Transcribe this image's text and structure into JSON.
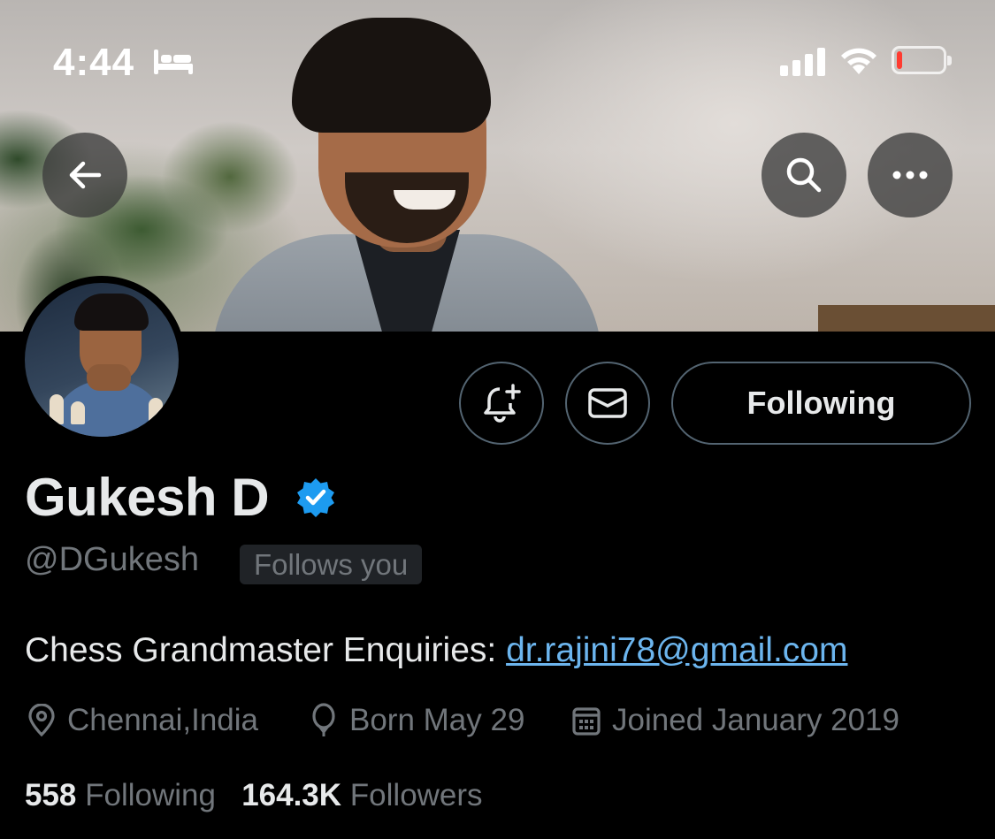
{
  "status_bar": {
    "time": "4:44",
    "sleep_icon": "bed-icon",
    "signal_icon": "cellular-signal-icon",
    "wifi_icon": "wifi-icon",
    "battery_icon": "battery-low-icon",
    "battery_level": 0.1,
    "battery_color": "#ff3b30"
  },
  "nav": {
    "back_icon": "arrow-left-icon",
    "search_icon": "search-icon",
    "more_icon": "more-horizontal-icon"
  },
  "actions": {
    "notify_icon": "bell-plus-icon",
    "message_icon": "envelope-icon",
    "following_label": "Following"
  },
  "profile": {
    "display_name": "Gukesh D",
    "verified_icon": "verified-badge-icon",
    "verified_color": "#1d9bf0",
    "handle": "@DGukesh",
    "follows_you": "Follows you",
    "bio_text": "Chess Grandmaster Enquiries: ",
    "bio_link": "dr.rajini78@gmail.com",
    "link_color": "#6cb5ee",
    "location": "Chennai,India",
    "birthday": "Born May 29",
    "joined": "Joined January 2019",
    "following_count": "558",
    "following_label": "Following",
    "followers_count": "164.3K",
    "followers_label": "Followers"
  }
}
